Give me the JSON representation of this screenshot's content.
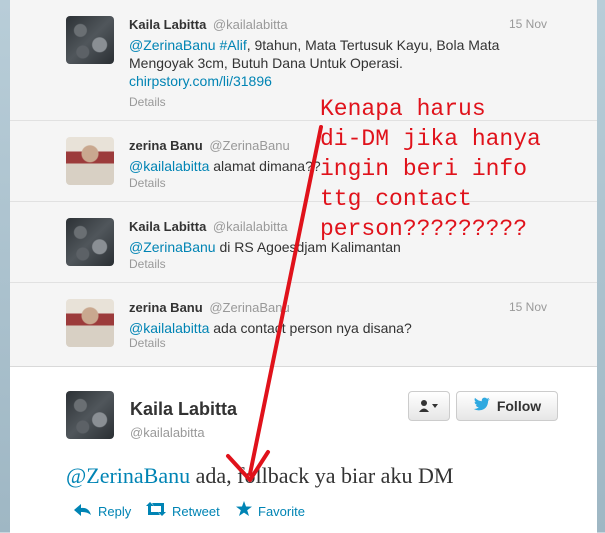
{
  "timeline": {
    "tweets": [
      {
        "name": "Kaila Labitta",
        "handle": "@kailalabitta",
        "time": "15 Nov",
        "mention1": "@ZerinaBanu",
        "hashtag": "#Alif",
        "line1_rest": ", 9tahun, Mata Tertusuk Kayu, Bola Mata",
        "line2": "Mengoyak 3cm, Butuh Dana Untuk Operasi.",
        "link": "chirpstory.com/li/31896",
        "details": "Details"
      },
      {
        "name": "zerina Banu",
        "handle": "@ZerinaBanu",
        "time": "",
        "mention": "@kailalabitta",
        "text": " alamat dimana??",
        "details": "Details"
      },
      {
        "name": "Kaila Labitta",
        "handle": "@kailalabitta",
        "time": "",
        "mention": "@ZerinaBanu",
        "text": " di RS Agoesdjam Kalimantan",
        "details": "Details"
      },
      {
        "name": "zerina Banu",
        "handle": "@ZerinaBanu",
        "time": "15 Nov",
        "mention": "@kailalabitta",
        "text": " ada contact person nya disana?",
        "details": "Details"
      }
    ]
  },
  "expanded_tweet": {
    "name": "Kaila Labitta",
    "handle": "@kailalabitta",
    "follow_label": "Follow",
    "user_menu_icon": "person-dropdown-icon",
    "mention": "@ZerinaBanu",
    "text": " ada, follback ya biar aku DM",
    "actions": {
      "reply": "Reply",
      "retweet": "Retweet",
      "favorite": "Favorite"
    }
  },
  "annotation": {
    "lines": [
      "Kenapa harus",
      "di-DM jika hanya",
      "ingin beri info",
      "ttg contact",
      "person?????????"
    ],
    "color": "#e0121b"
  },
  "colors": {
    "link": "#0084b4",
    "twitter_blue": "#2fa9e0"
  }
}
